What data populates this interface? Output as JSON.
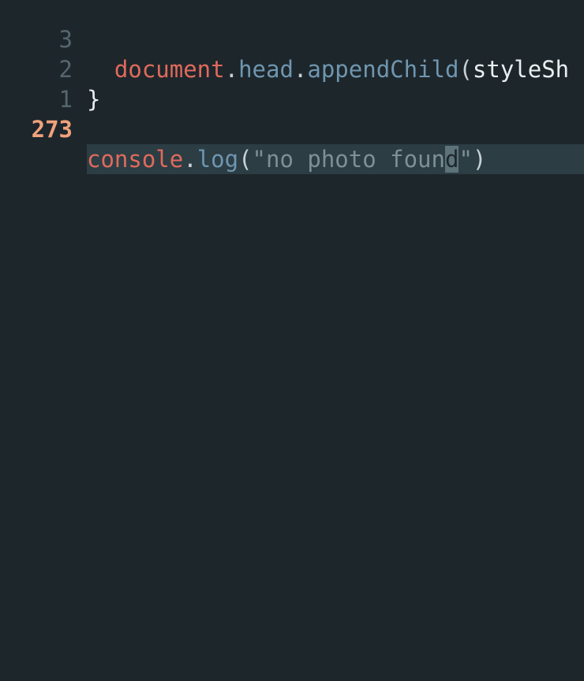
{
  "editor": {
    "lines": [
      {
        "number": "3",
        "indent": "  ",
        "tokens": [
          "document",
          ".",
          "head",
          ".",
          "appendChild",
          "(",
          "styleSh"
        ]
      },
      {
        "number": "2",
        "indent": "",
        "tokens": [
          "}"
        ]
      },
      {
        "number": "1",
        "indent": "",
        "tokens": []
      },
      {
        "number": "273",
        "indent": "",
        "current": true,
        "tokens": [
          "console",
          ".",
          "log",
          "(",
          "\"no photo foun",
          "d",
          "\"",
          ")"
        ]
      }
    ],
    "cursor_char": "d"
  },
  "colors": {
    "background": "#1d262b",
    "current_line_bg": "#2c3d44",
    "gutter_text": "#55666d",
    "gutter_current": "#f0a27c",
    "identifier": "#e06a5c",
    "method": "#6f96b0",
    "string": "#7d9096",
    "cursor_bg": "#5d7279"
  }
}
